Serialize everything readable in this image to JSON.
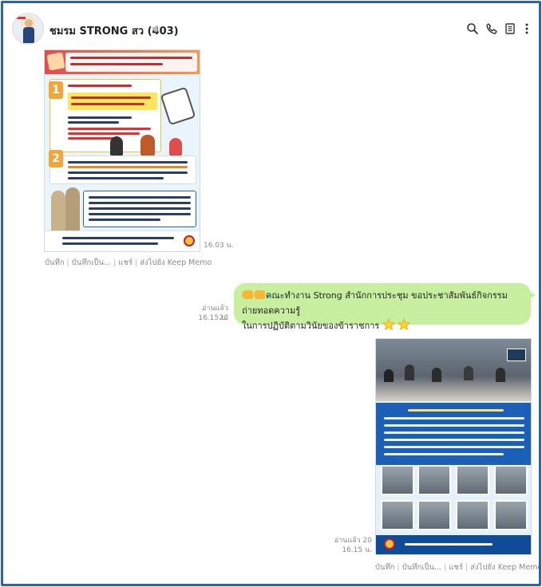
{
  "header": {
    "title": "ชมรม STRONG สว (403)",
    "icons": [
      "search-icon",
      "phone-icon",
      "notes-icon",
      "more-icon"
    ]
  },
  "messages": [
    {
      "type": "image",
      "time": "16.03 น.",
      "actions": [
        "บันทึก",
        "บันทึกเป็น...",
        "แชร์",
        "ส่งไปยัง Keep Memo"
      ]
    },
    {
      "type": "text",
      "read": "อ่านแล้ว 23",
      "time": "16.15 น.",
      "text_line1": "คณะทำงาน Strong สำนักการประชุม ขอประชาสัมพันธ์กิจกรรมถ่ายทอดความรู้",
      "text_line2": "ในการปฏิบัติตามวินัยของข้าราชการ"
    },
    {
      "type": "image",
      "read": "อ่านแล้ว 20",
      "time": "16.15 น.",
      "actions": [
        "บันทึก",
        "บันทึกเป็น...",
        "แชร์",
        "ส่งไปยัง Keep Memo"
      ]
    }
  ],
  "colors": {
    "frame": "#2a64ad",
    "bubble": "#c7ef9f"
  }
}
